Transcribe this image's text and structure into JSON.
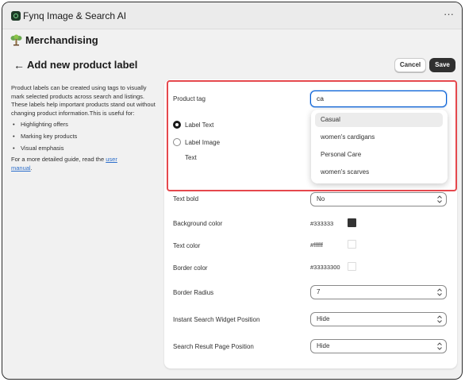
{
  "app": {
    "title": "Fynq Image & Search AI",
    "menu_icon": "more-horizontal-icon"
  },
  "section": {
    "title": "Merchandising",
    "icon": "tree-icon"
  },
  "page": {
    "title": "Add new product label",
    "back_icon": "arrow-left-icon"
  },
  "actions": {
    "cancel_label": "Cancel",
    "save_label": "Save"
  },
  "description": {
    "intro": "Product labels can be created using tags to visually mark selected products across search and listings. These labels help important products stand out without changing product information.This is useful for:",
    "bullets": [
      "Highlighting offers",
      "Marking key products",
      "Visual emphasis"
    ],
    "guide_prefix": "For a more detailed guide, read the ",
    "guide_link_part1": "user",
    "guide_link_part2": "manual",
    "guide_suffix": "."
  },
  "form": {
    "product_tag": {
      "label": "Product tag",
      "value": "ca"
    },
    "label_type": {
      "options": [
        {
          "label": "Label Text",
          "checked": true
        },
        {
          "label": "Label Image",
          "checked": false
        }
      ],
      "text_label": "Text"
    },
    "tag_suggestions": [
      "Casual",
      "women's cardigans",
      "Personal Care",
      "women's scarves"
    ],
    "text_bold": {
      "label": "Text bold",
      "value": "No"
    },
    "background_color": {
      "label": "Background color",
      "value": "#333333",
      "swatch": "#333333"
    },
    "text_color": {
      "label": "Text color",
      "value": "#ffffff",
      "swatch": "#ffffff"
    },
    "border_color": {
      "label": "Border color",
      "value": "#33333300",
      "swatch": "#ffffff"
    },
    "border_radius": {
      "label": "Border Radius",
      "value": "7"
    },
    "widget_position": {
      "label": "Instant Search Widget Position",
      "value": "Hide"
    },
    "result_page_position": {
      "label": "Search Result Page Position",
      "value": "Hide"
    }
  },
  "colors": {
    "accent": "#005bd3",
    "highlight": "#e5484d",
    "primary_button": "#303030"
  }
}
